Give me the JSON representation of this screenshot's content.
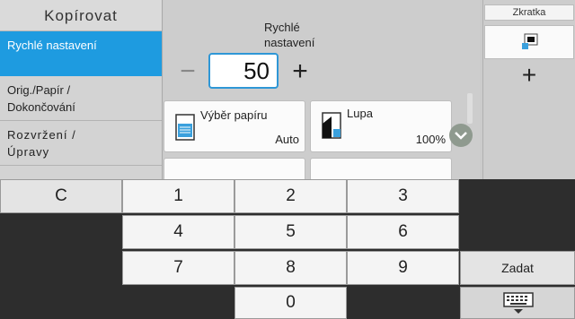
{
  "nav": {
    "title": "Kopírovat",
    "items": [
      {
        "label": "Rychlé nastavení",
        "active": true
      },
      {
        "label": "Orig./Papír / Dokončování",
        "active": false
      },
      {
        "label": "Rozvržení /Úpravy",
        "active": false
      }
    ]
  },
  "quick_setting": {
    "label": "Rychlé nastavení",
    "copies_value": "50",
    "minus_symbol": "−",
    "plus_symbol": "+"
  },
  "tiles": [
    {
      "label": "Výběr papíru",
      "value": "Auto",
      "icon": "paper-tray-icon"
    },
    {
      "label": "Lupa",
      "value": "100%",
      "icon": "zoom-page-icon"
    }
  ],
  "shortcut": {
    "header": "Zkratka",
    "add_symbol": "+"
  },
  "keypad": {
    "clear": "C",
    "digits": [
      "1",
      "2",
      "3",
      "4",
      "5",
      "6",
      "7",
      "8",
      "9",
      "0"
    ],
    "enter": "Zadat"
  },
  "colors": {
    "accent": "#1e9be0",
    "field_border": "#2f97d6",
    "background_dark": "#2d2d2d",
    "panel": "#cdcdcd"
  }
}
